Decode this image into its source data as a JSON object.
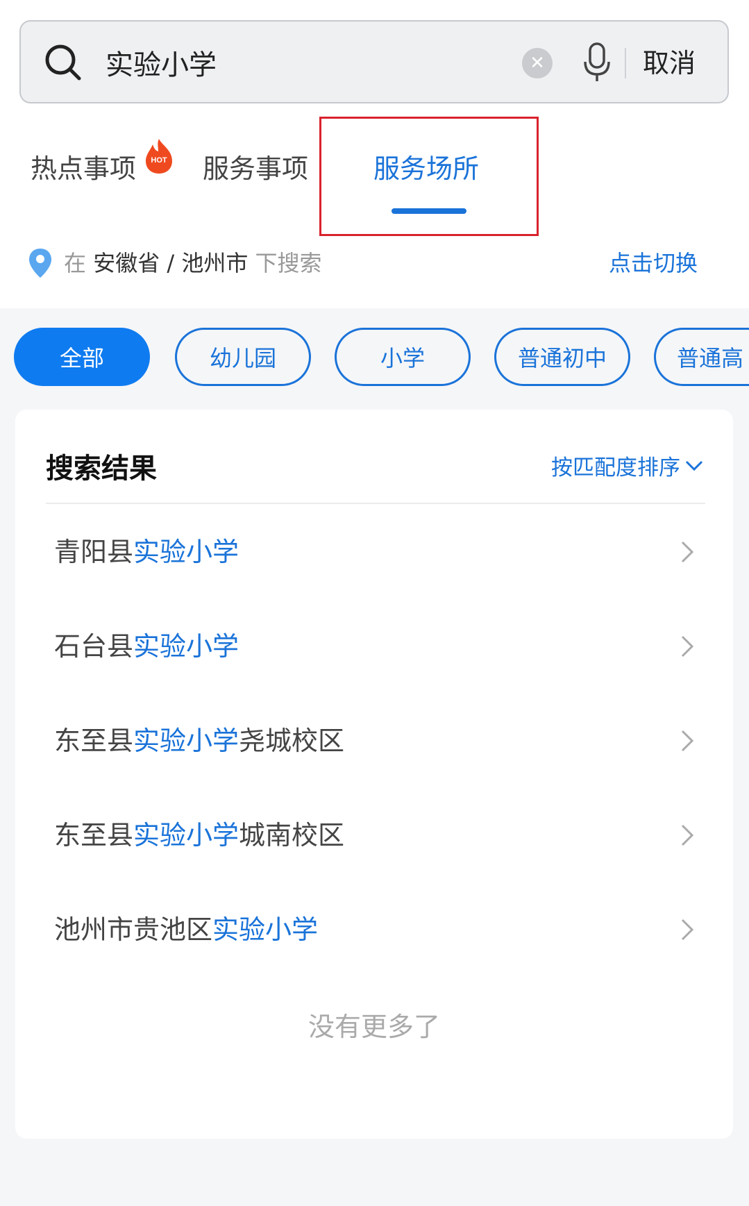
{
  "search": {
    "value": "实验小学",
    "cancel_label": "取消"
  },
  "tabs": [
    {
      "label": "热点事项",
      "badge": "HOT"
    },
    {
      "label": "服务事项"
    },
    {
      "label": "服务场所",
      "active": true
    }
  ],
  "location": {
    "prefix": "在",
    "region": "安徽省 / 池州市",
    "suffix": "下搜索",
    "switch_label": "点击切换"
  },
  "filters": [
    "全部",
    "幼儿园",
    "小学",
    "普通初中",
    "普通高"
  ],
  "results": {
    "title": "搜索结果",
    "sort_label": "按匹配度排序",
    "items": [
      {
        "pre": "青阳县",
        "hl": "实验小学",
        "post": ""
      },
      {
        "pre": "石台县",
        "hl": "实验小学",
        "post": ""
      },
      {
        "pre": "东至县",
        "hl": "实验小学",
        "post": "尧城校区"
      },
      {
        "pre": "东至县",
        "hl": "实验小学",
        "post": "城南校区"
      },
      {
        "pre": "池州市贵池区",
        "hl": "实验小学",
        "post": ""
      }
    ],
    "end_text": "没有更多了"
  },
  "colors": {
    "accent": "#1a73d9",
    "chip_active": "#0f7bf0",
    "highlight_box": "#d9232d",
    "hot_badge": "#ef4a1f"
  },
  "icons": [
    "search-icon",
    "clear-icon",
    "mic-icon",
    "hot-icon",
    "pin-icon",
    "chevron-down-icon",
    "chevron-right-icon"
  ]
}
